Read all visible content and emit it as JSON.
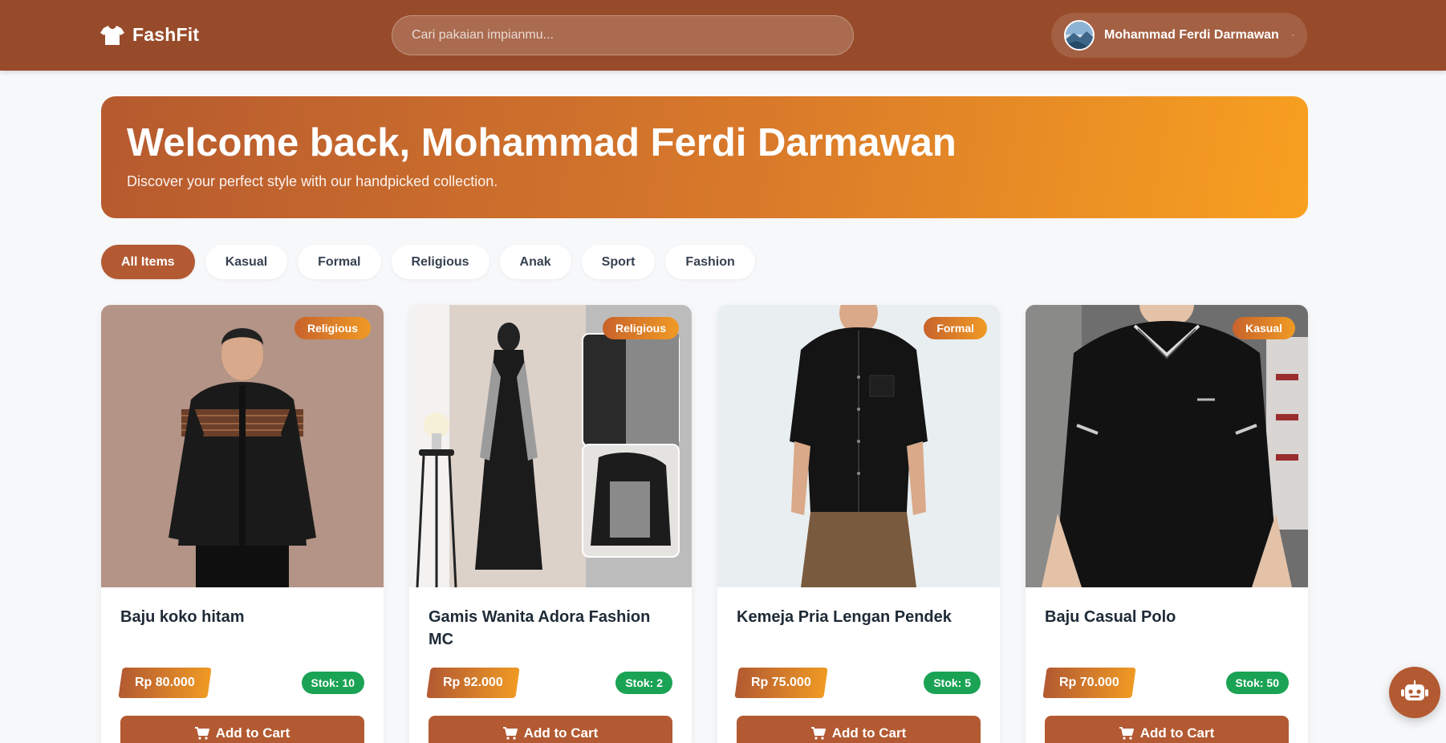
{
  "brand": {
    "name": "FashFit",
    "icon": "shirt-icon"
  },
  "search": {
    "placeholder": "Cari pakaian impianmu..."
  },
  "user": {
    "name": "Mohammad Ferdi Darmawan",
    "avatar": "avatar-icon",
    "menu_icon": "chevron-down-icon"
  },
  "hero": {
    "title": "Welcome back, Mohammad Ferdi Darmawan",
    "subtitle": "Discover your perfect style with our handpicked collection."
  },
  "categories": [
    {
      "label": "All Items",
      "active": true
    },
    {
      "label": "Kasual",
      "active": false
    },
    {
      "label": "Formal",
      "active": false
    },
    {
      "label": "Religious",
      "active": false
    },
    {
      "label": "Anak",
      "active": false
    },
    {
      "label": "Sport",
      "active": false
    },
    {
      "label": "Fashion",
      "active": false
    }
  ],
  "products": [
    {
      "name": "Baju koko hitam",
      "category": "Religious",
      "price": "Rp 80.000",
      "stock": "Stok: 10",
      "button": "Add to Cart"
    },
    {
      "name": "Gamis Wanita Adora Fashion MC",
      "category": "Religious",
      "price": "Rp 92.000",
      "stock": "Stok: 2",
      "button": "Add to Cart"
    },
    {
      "name": "Kemeja Pria Lengan Pendek",
      "category": "Formal",
      "price": "Rp 75.000",
      "stock": "Stok: 5",
      "button": "Add to Cart"
    },
    {
      "name": "Baju Casual Polo",
      "category": "Kasual",
      "price": "Rp 70.000",
      "stock": "Stok: 50",
      "button": "Add to Cart"
    }
  ],
  "chat_fab": {
    "icon": "robot-icon"
  },
  "colors": {
    "navbar": "#984b2a",
    "accent": "#b35a32",
    "gradient_end": "#f8a020",
    "stock_green": "#1aa354"
  }
}
